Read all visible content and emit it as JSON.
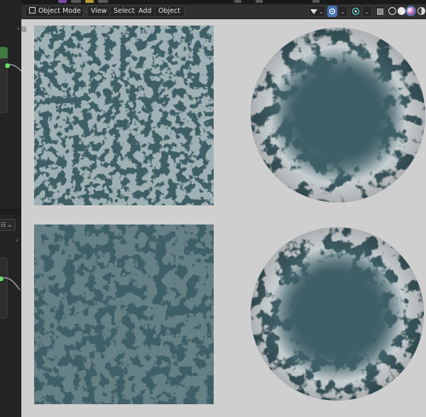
{
  "header": {
    "mode_label": "Object Mode",
    "menu": [
      "View",
      "Select",
      "Add",
      "Object"
    ]
  },
  "icons": {
    "mode": "object-mode-icon",
    "transform": "cursor-transform-icon",
    "overlays": "overlays-icon",
    "gizmo": "gizmo-icon",
    "xray": "xray-icon",
    "shading_wire": "wireframe-shading-icon",
    "shading_solid": "solid-shading-icon",
    "shading_material": "material-preview-icon",
    "shading_rendered": "rendered-shading-icon"
  },
  "colors": {
    "viewport_bg": "#cfcfcf",
    "material_teal": "#3f5f66",
    "header_bg": "#303030",
    "accent_blue": "#4772b3",
    "node_green": "#6bd86b"
  }
}
